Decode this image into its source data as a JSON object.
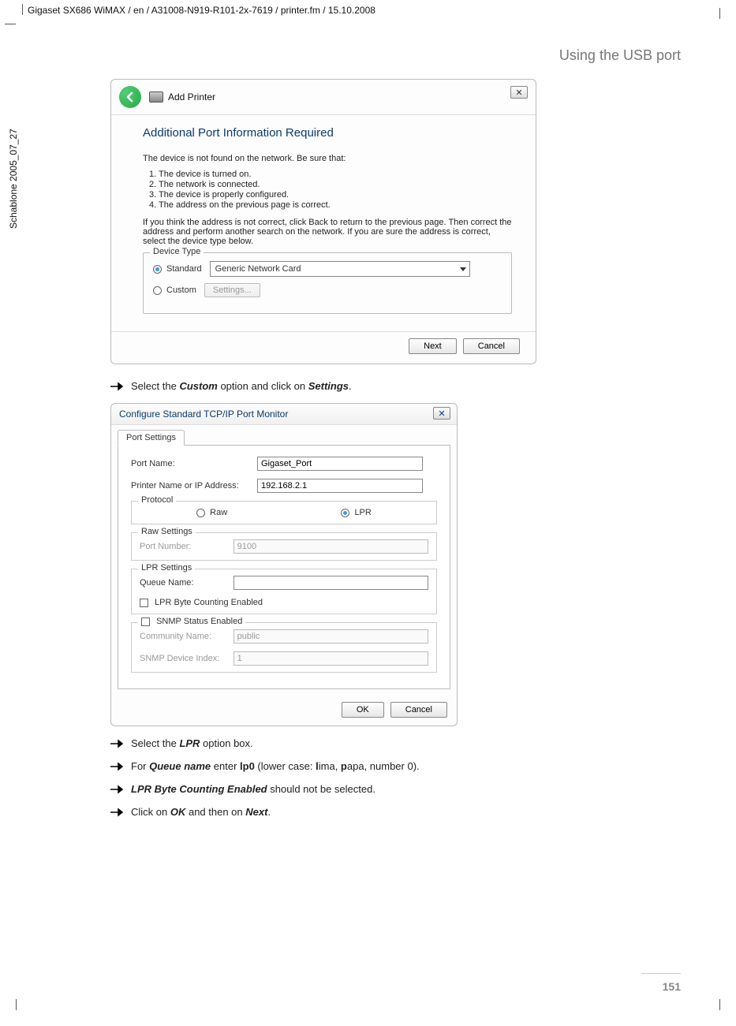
{
  "doc_path": "Gigaset SX686 WiMAX / en / A31008-N919-R101-2x-7619 / printer.fm / 15.10.2008",
  "side_label": "Schablone 2005_07_27",
  "section_title": "Using the USB port",
  "dialog1": {
    "title": "Add Printer",
    "heading": "Additional Port Information Required",
    "intro": "The device is not found on the network.  Be sure that:",
    "list": {
      "i1": "1.    The device is turned on.",
      "i2": "2.    The network is connected.",
      "i3": "3.    The device is properly configured.",
      "i4": "4.    The address on the previous page is correct."
    },
    "para": "If you think the address is not correct, click Back to return to the previous page.  Then correct the address and perform another search on the network.  If you are sure the address is correct, select the device type below.",
    "device_type_label": "Device Type",
    "standard_label": "Standard",
    "custom_label": "Custom",
    "dropdown_value": "Generic Network Card",
    "settings_btn": "Settings...",
    "next_btn": "Next",
    "cancel_btn": "Cancel"
  },
  "instructions": {
    "i1_a": "Select the ",
    "i1_b": "Custom",
    "i1_c": " option and click on ",
    "i1_d": "Settings",
    "i1_e": ".",
    "i2_a": "Select the ",
    "i2_b": "LPR",
    "i2_c": " option box.",
    "i3_a": "For ",
    "i3_b": "Queue name",
    "i3_c": " enter ",
    "i3_d": "lp0",
    "i3_e": " (lower case: ",
    "i3_f": "l",
    "i3_g": "ima, ",
    "i3_h": "p",
    "i3_i": "apa, number 0).",
    "i4_a": "",
    "i4_b": "LPR Byte Counting Enabled",
    "i4_c": " should not be selected.",
    "i5_a": "Click on ",
    "i5_b": "OK",
    "i5_c": " and then on ",
    "i5_d": "Next",
    "i5_e": "."
  },
  "dialog2": {
    "title": "Configure Standard TCP/IP Port Monitor",
    "tab": "Port Settings",
    "port_name_label": "Port Name:",
    "port_name_value": "Gigaset_Port",
    "printer_label": "Printer Name or IP Address:",
    "printer_value": "192.168.2.1",
    "protocol_legend": "Protocol",
    "raw_label": "Raw",
    "lpr_label": "LPR",
    "raw_settings_legend": "Raw Settings",
    "port_number_label": "Port Number:",
    "port_number_value": "9100",
    "lpr_settings_legend": "LPR Settings",
    "queue_label": "Queue Name:",
    "queue_value": "",
    "byte_counting_label": "LPR Byte Counting Enabled",
    "snmp_legend": "SNMP Status Enabled",
    "community_label": "Community Name:",
    "community_value": "public",
    "snmp_index_label": "SNMP Device Index:",
    "snmp_index_value": "1",
    "ok_btn": "OK",
    "cancel_btn": "Cancel"
  },
  "page_number": "151"
}
